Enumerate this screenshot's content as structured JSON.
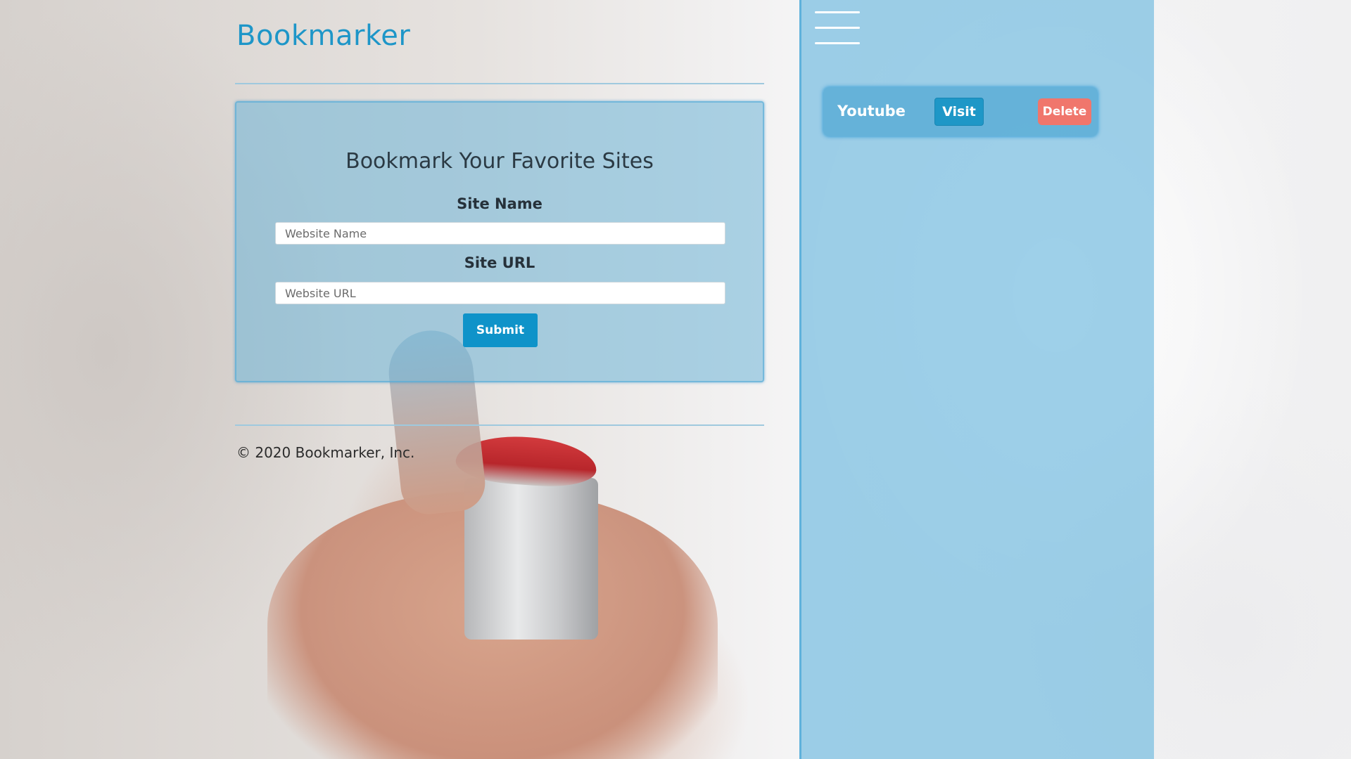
{
  "brand": {
    "title": "Bookmarker"
  },
  "form": {
    "heading": "Bookmark Your Favorite Sites",
    "site_name_label": "Site Name",
    "site_name_placeholder": "Website Name",
    "site_url_label": "Site URL",
    "site_url_placeholder": "Website URL",
    "submit_label": "Submit"
  },
  "footer": {
    "copyright": "© 2020 Bookmarker, Inc."
  },
  "panel": {
    "menu_icon": "hamburger-menu-icon",
    "bookmarks": [
      {
        "name": "Youtube",
        "visit_label": "Visit",
        "delete_label": "Delete"
      }
    ]
  },
  "colors": {
    "brand": "#1e96c8",
    "primary_button": "#0f93c9",
    "delete_button": "#f0766c",
    "panel": "#78bee1"
  }
}
